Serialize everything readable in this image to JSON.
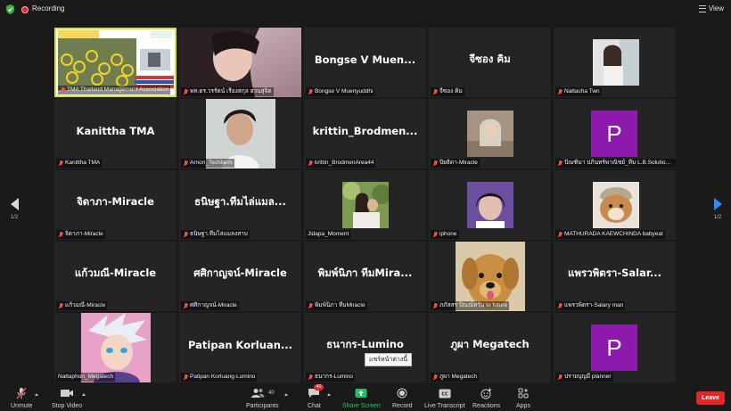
{
  "top_bar": {
    "recording_label": "Recording",
    "view_label": "View",
    "colors": {
      "recording": "#e02828",
      "shield": "#3cb043"
    }
  },
  "pagination": {
    "left_label": "1/2",
    "right_label": "1/2"
  },
  "grid": {
    "tiles": [
      {
        "title": "",
        "label": "TMA Thailand Management Association",
        "kind": "screen",
        "active": true
      },
      {
        "title": "",
        "label": "พท.ดร.วรรัตน์ เรืองสกุล ฮวนสุจิต",
        "kind": "photo-portrait"
      },
      {
        "title": "Bongse V Muen...",
        "label": "Bongse V Muenyuddhi"
      },
      {
        "title": "จีซอง คิม",
        "label": "จีซอง คิม"
      },
      {
        "title": "",
        "label": "Nattacha Twn",
        "kind": "photo-small"
      },
      {
        "title": "Kanittha TMA",
        "label": "Kanittha TMA"
      },
      {
        "title": "",
        "label": "Arnon_Techfarm",
        "kind": "photo-man"
      },
      {
        "title": "krittin_Brodmen...",
        "label": "krittin_BrodmenArea44"
      },
      {
        "title": "",
        "label": "ปิยธิดา-Miracle",
        "kind": "photo-small-warm"
      },
      {
        "title": "",
        "label": "ปัณฑิมา ปภินทร์พาณิชย์_ทีม L.B.Solution Tech",
        "kind": "avatar",
        "avatar_letter": "P"
      },
      {
        "title": "จิดาภา-Miracle",
        "label": "จิดาภา-Miracle"
      },
      {
        "title": "ธนิษฐา.ทีมไล่แมล...",
        "label": "ธนิษฐา.ทีมไล่แมลงสาบ"
      },
      {
        "title": "",
        "label": "Jidapa_Moment",
        "kind": "photo-small-green"
      },
      {
        "title": "",
        "label": "iphone",
        "kind": "photo-small-purple"
      },
      {
        "title": "",
        "label": "MATHURADA KAEWCHINDA babyeat",
        "kind": "photo-dog-small"
      },
      {
        "title": "แก้วมณี-Miracle",
        "label": "แก้วมณี-Miracle"
      },
      {
        "title": "ศศิกาญจน์-Miracle",
        "label": "ศศิกาญจน์-Miracle"
      },
      {
        "title": "พิมพ์นิภา ทีมMira...",
        "label": "พิมพ์นิภา ทีมMiracle"
      },
      {
        "title": "",
        "label": "ภภัสสร ปัณณ์ทวัน to future",
        "kind": "photo-dog"
      },
      {
        "title": "แพรวพิตรา-Salar...",
        "label": "แพรวพิตรา-Salary man"
      },
      {
        "title": "",
        "label": "Nattaphon_Megatech",
        "kind": "photo-anime"
      },
      {
        "title": "Patipan Korluan...",
        "label": "Patipan Korluang-Lumino"
      },
      {
        "title": "ธนากร-Lumino",
        "label": "ธนากร-Lumino"
      },
      {
        "title": "ภูผา Megatech",
        "label": "ภูผา Megatech"
      },
      {
        "title": "",
        "label": "ปรายบุญมี planner",
        "kind": "avatar",
        "avatar_letter": "P"
      }
    ],
    "tooltip": "แชร์หน้าต่างนี้",
    "colors": {
      "active_border": "#d7e236",
      "avatar_bg": "#8e19ad",
      "muted_mic": "#ff4d4d"
    }
  },
  "toolbar": {
    "unmute_label": "Unmute",
    "stop_video_label": "Stop Video",
    "participants_label": "Participants",
    "participants_count": "40",
    "chat_label": "Chat",
    "chat_badge": "40",
    "share_label": "Share Screen",
    "record_label": "Record",
    "transcript_label": "Live Transcript",
    "reactions_label": "Reactions",
    "apps_label": "Apps",
    "leave_label": "Leave",
    "colors": {
      "share": "#21c25e",
      "leave": "#e02828"
    }
  }
}
